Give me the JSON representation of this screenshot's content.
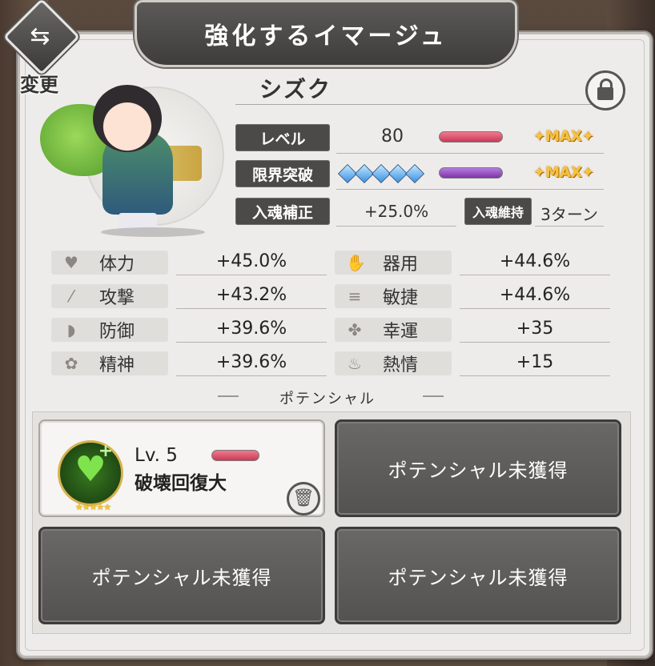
{
  "header": {
    "title": "強化するイマージュ",
    "change_label": "変更"
  },
  "character": {
    "name": "シズク"
  },
  "rows": {
    "level": {
      "label": "レベル",
      "value": "80",
      "max": "✦MAX✦"
    },
    "limit_break": {
      "label": "限界突破",
      "gems": 5,
      "max": "✦MAX✦"
    },
    "soul_bonus": {
      "label": "入魂補正",
      "value": "+25.0%"
    },
    "soul_keep": {
      "label": "入魂維持",
      "value": "3ターン"
    }
  },
  "stats_left": [
    {
      "icon": "heart-icon",
      "label": "体力",
      "value": "+45.0%"
    },
    {
      "icon": "sword-icon",
      "label": "攻撃",
      "value": "+43.2%"
    },
    {
      "icon": "shield-icon",
      "label": "防御",
      "value": "+39.6%"
    },
    {
      "icon": "spirit-icon",
      "label": "精神",
      "value": "+39.6%"
    }
  ],
  "stats_right": [
    {
      "icon": "hand-icon",
      "label": "器用",
      "value": "+44.6%"
    },
    {
      "icon": "speed-icon",
      "label": "敏捷",
      "value": "+44.6%"
    },
    {
      "icon": "clover-icon",
      "label": "幸運",
      "value": "+35"
    },
    {
      "icon": "flame-icon",
      "label": "熱情",
      "value": "+15"
    }
  ],
  "potential": {
    "section_title": "ポテンシャル",
    "slot1": {
      "level": "Lv. 5",
      "name": "破壊回復大",
      "stars": "★★★★★"
    },
    "empty_label": "ポテンシャル未獲得"
  }
}
